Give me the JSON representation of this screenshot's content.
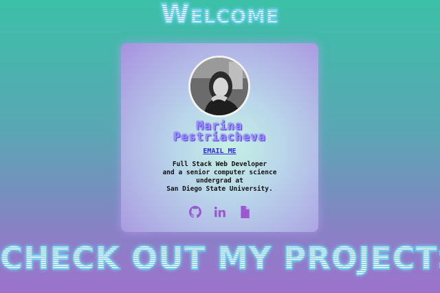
{
  "header": {
    "title": "Welcome"
  },
  "profile": {
    "name_first": "Marina",
    "name_last": "Pestriacheva",
    "email_label": "EMAIL ME",
    "bio_lines": [
      "Full Stack Web Developer",
      "and a senior computer science",
      "undergrad at",
      "San Diego State University."
    ],
    "icons": [
      "github-icon",
      "linkedin-icon",
      "resume-file-icon"
    ]
  },
  "footer": {
    "title": "CHECK OUT MY PROJECTS"
  },
  "colors": {
    "accent": "#a28ef0",
    "link": "#2a2ae6",
    "icon": "#9b59d0"
  }
}
